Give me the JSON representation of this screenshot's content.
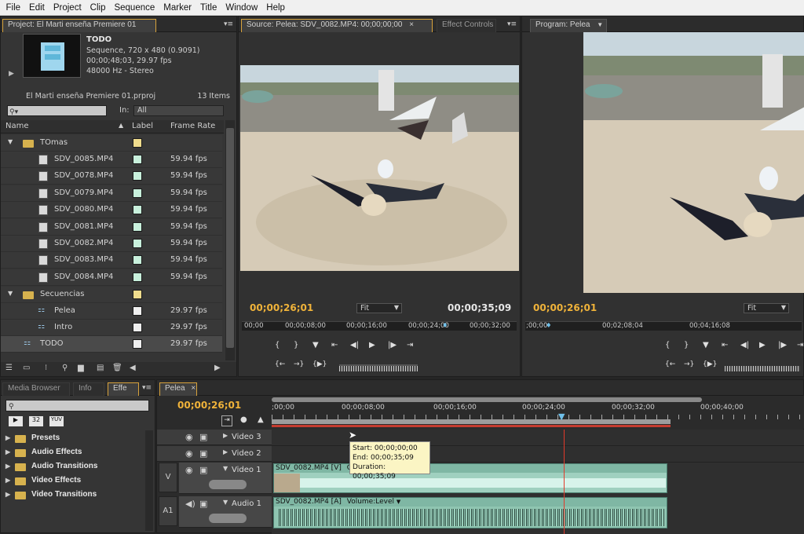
{
  "menu": [
    "File",
    "Edit",
    "Project",
    "Clip",
    "Sequence",
    "Marker",
    "Title",
    "Window",
    "Help"
  ],
  "project": {
    "tab": "Project: El Marti enseña Premiere 01",
    "seq_name": "TODO",
    "seq_info1": "Sequence, 720 x 480 (0.9091)",
    "seq_info2": "00;00;48;03, 29.97 fps",
    "seq_info3": "48000 Hz - Stereo",
    "file": "El Marti enseña Premiere 01.prproj",
    "items": "13 Items",
    "in_label": "In:",
    "in_value": "All",
    "col_name": "Name",
    "col_label": "Label",
    "col_rate": "Frame Rate",
    "folder1": "TOmas",
    "clips": [
      {
        "name": "SDV_0085.MP4",
        "rate": "59.94 fps"
      },
      {
        "name": "SDV_0078.MP4",
        "rate": "59.94 fps"
      },
      {
        "name": "SDV_0079.MP4",
        "rate": "59.94 fps"
      },
      {
        "name": "SDV_0080.MP4",
        "rate": "59.94 fps"
      },
      {
        "name": "SDV_0081.MP4",
        "rate": "59.94 fps"
      },
      {
        "name": "SDV_0082.MP4",
        "rate": "59.94 fps"
      },
      {
        "name": "SDV_0083.MP4",
        "rate": "59.94 fps"
      },
      {
        "name": "SDV_0084.MP4",
        "rate": "59.94 fps"
      }
    ],
    "folder2": "Secuencias",
    "seqs": [
      {
        "name": "Pelea",
        "rate": "29.97 fps"
      },
      {
        "name": "Intro",
        "rate": "29.97 fps"
      }
    ],
    "todo": {
      "name": "TODO",
      "rate": "29.97 fps"
    }
  },
  "source": {
    "tab": "Source: Pelea: SDV_0082.MP4: 00;00;00;00",
    "tab2": "Effect Controls",
    "timecode": "00;00;26;01",
    "fit": "Fit",
    "duration": "00;00;35;09",
    "ruler": [
      "00;00",
      "00;00;08;00",
      "00;00;16;00",
      "00;00;24;00",
      "00;00;32;00"
    ]
  },
  "program": {
    "tab": "Program: Pelea",
    "timecode": "00;00;26;01",
    "fit": "Fit",
    "ruler": [
      ";00;00",
      "00;02;08;04",
      "00;04;16;08"
    ]
  },
  "effects": {
    "tabs": [
      "Media Browser",
      "Info",
      "Effe"
    ],
    "badges": [
      "32",
      "YUV"
    ],
    "folders": [
      "Presets",
      "Audio Effects",
      "Audio Transitions",
      "Video Effects",
      "Video Transitions"
    ]
  },
  "timeline": {
    "tab": "Pelea",
    "timecode": "00;00;26;01",
    "ruler": [
      ";00;00",
      "00;00;08;00",
      "00;00;16;00",
      "00;00;24;00",
      "00;00;32;00",
      "00;00;40;00"
    ],
    "tracks": [
      "Video 3",
      "Video 2",
      "Video 1",
      "Audio 1"
    ],
    "v_label": "V",
    "a_label": "A1",
    "video_clip": "SDV_0082.MP4 [V]",
    "video_clip_o": "O",
    "audio_clip": "SDV_0082.MP4 [A]",
    "audio_volume": "Volume:Level",
    "tooltip": {
      "start": "Start: 00;00;00;00",
      "end": "End: 00;00;35;09",
      "duration": "Duration: 00;00;35;09"
    }
  },
  "colors": {
    "timecode": "#f0b33a",
    "label_yellow": "#efdc8d",
    "label_mint": "#c8f0dc",
    "playhead": "#e23a2a"
  }
}
